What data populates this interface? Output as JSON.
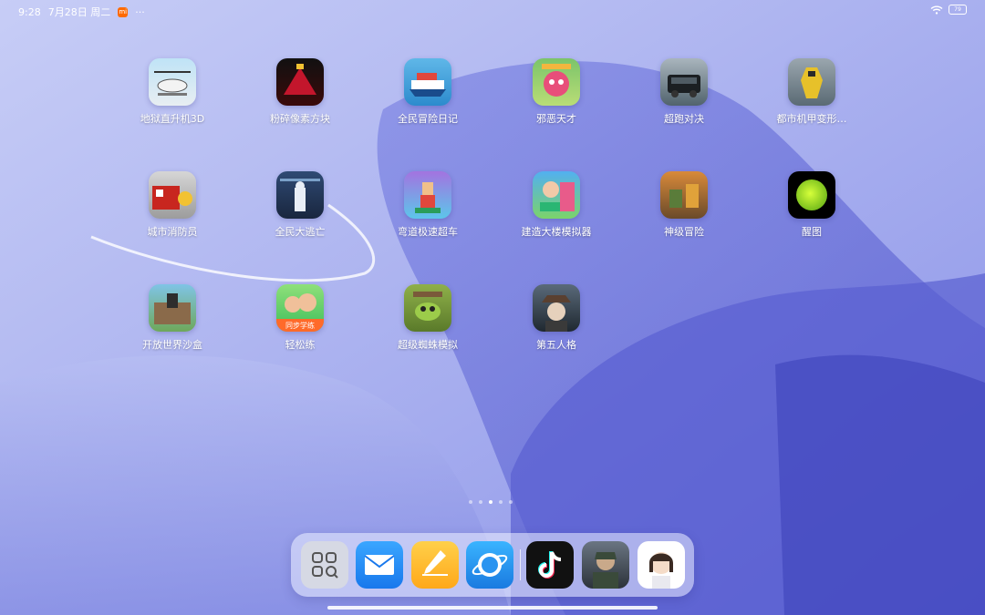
{
  "status_bar": {
    "time": "9:28",
    "date": "7月28日 周二",
    "mi_badge": "mi",
    "more": "···",
    "battery": "79"
  },
  "apps": [
    {
      "label": "地狱直升机3D",
      "icon": "helicopter-icon"
    },
    {
      "label": "粉碎像素方块",
      "icon": "pixel-blocks-icon"
    },
    {
      "label": "全民冒险日记",
      "icon": "ship-icon"
    },
    {
      "label": "邪恶天才",
      "icon": "evil-genius-icon"
    },
    {
      "label": "超跑对决",
      "icon": "suv-icon"
    },
    {
      "label": "都市机甲变形…",
      "icon": "mecha-icon"
    },
    {
      "label": "城市消防员",
      "icon": "fire-truck-icon"
    },
    {
      "label": "全民大逃亡",
      "icon": "escape-icon"
    },
    {
      "label": "弯道极速超车",
      "icon": "racer-icon"
    },
    {
      "label": "建造大楼模拟器",
      "icon": "builder-icon"
    },
    {
      "label": "神级冒险",
      "icon": "adventure-icon"
    },
    {
      "label": "醒图",
      "icon": "xingtu-icon"
    },
    {
      "label": "开放世界沙盒",
      "icon": "sandbox-icon"
    },
    {
      "label": "轻松练",
      "icon": "study-icon",
      "badge": "同步学练"
    },
    {
      "label": "超级蜘蛛模拟",
      "icon": "spider-icon"
    },
    {
      "label": "第五人格",
      "icon": "identity-v-icon"
    }
  ],
  "page_dots": {
    "count": 5,
    "active_index": 2
  },
  "dock": [
    {
      "name": "app-drawer",
      "icon": "app-drawer-icon"
    },
    {
      "name": "mail",
      "icon": "mail-icon"
    },
    {
      "name": "notes",
      "icon": "notes-icon"
    },
    {
      "name": "browser",
      "icon": "browser-icon"
    },
    {
      "name": "tiktok",
      "icon": "tiktok-icon"
    },
    {
      "name": "shooter-game",
      "icon": "soldier-icon"
    },
    {
      "name": "avatar-app",
      "icon": "avatar-icon"
    }
  ]
}
